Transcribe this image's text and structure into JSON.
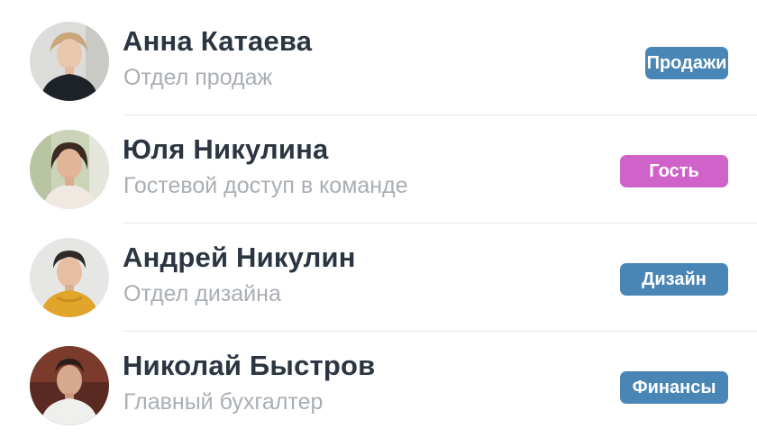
{
  "colors": {
    "sales": "#4a86b5",
    "guest": "#d063c9",
    "design": "#4a86b5",
    "finance": "#4a86b5"
  },
  "users": [
    {
      "name": "Анна Катаева",
      "subtitle": "Отдел продаж",
      "tag": "Продажи",
      "tag_color": "#4a86b5"
    },
    {
      "name": "Юля Никулина",
      "subtitle": "Гостевой доступ в команде",
      "tag": "Гость",
      "tag_color": "#d063c9"
    },
    {
      "name": "Андрей Никулин",
      "subtitle": "Отдел дизайна",
      "tag": "Дизайн",
      "tag_color": "#4a86b5"
    },
    {
      "name": "Николай Быстров",
      "subtitle": "Главный бухгалтер",
      "tag": "Финансы",
      "tag_color": "#4a86b5"
    }
  ]
}
